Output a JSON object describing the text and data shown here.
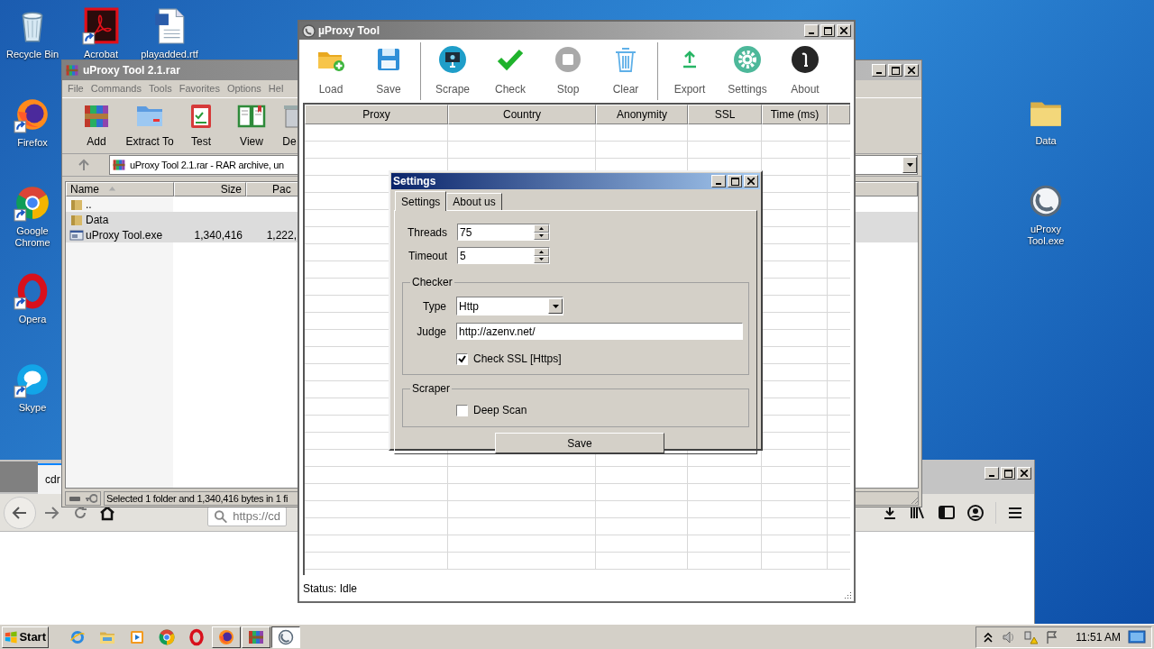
{
  "desktop_icons": [
    {
      "label": "Recycle Bin",
      "kind": "recycle",
      "shortcut": false
    },
    {
      "label": "Acrobat",
      "kind": "acrobat",
      "shortcut": true
    },
    {
      "label": "playadded.rtf",
      "kind": "document",
      "shortcut": false
    },
    {
      "label": "Firefox",
      "kind": "firefox",
      "shortcut": true
    },
    {
      "label": "Google Chrome",
      "kind": "chrome",
      "shortcut": true
    },
    {
      "label": "Opera",
      "kind": "opera",
      "shortcut": true
    },
    {
      "label": "Skype",
      "kind": "skype",
      "shortcut": true
    },
    {
      "label": "Data",
      "kind": "folder",
      "shortcut": false
    },
    {
      "label": "uProxy Tool.exe",
      "kind": "uproxy",
      "shortcut": false
    }
  ],
  "browser": {
    "tab": "cdr",
    "url": "https://cd"
  },
  "winrar": {
    "title": "uProxy Tool 2.1.rar",
    "menu": [
      "File",
      "Commands",
      "Tools",
      "Favorites",
      "Options",
      "Hel"
    ],
    "toolbar": [
      {
        "label": "Add",
        "kind": "add"
      },
      {
        "label": "Extract To",
        "kind": "extract"
      },
      {
        "label": "Test",
        "kind": "test"
      },
      {
        "label": "View",
        "kind": "view"
      },
      {
        "label": "De",
        "kind": "delete"
      }
    ],
    "path": "uProxy Tool 2.1.rar - RAR archive, un",
    "columns": [
      "Name",
      "Size",
      "Pac"
    ],
    "rows": [
      {
        "cells": [
          ".."
        ],
        "kind": "folder",
        "selected": false
      },
      {
        "cells": [
          "Data"
        ],
        "kind": "folder",
        "selected": true
      },
      {
        "cells": [
          "uProxy Tool.exe",
          "1,340,416",
          "1,222,"
        ],
        "kind": "file",
        "selected": true
      }
    ],
    "status": "Selected 1 folder and 1,340,416 bytes in 1 fi"
  },
  "uproxy": {
    "title": "µProxy Tool",
    "toolbar": [
      {
        "label": "Load",
        "kind": "load"
      },
      {
        "label": "Save",
        "kind": "save"
      },
      {
        "kind": "separator"
      },
      {
        "label": "Scrape",
        "kind": "scrape"
      },
      {
        "label": "Check",
        "kind": "check"
      },
      {
        "label": "Stop",
        "kind": "stop"
      },
      {
        "label": "Clear",
        "kind": "clear"
      },
      {
        "kind": "separator"
      },
      {
        "label": "Export",
        "kind": "export"
      },
      {
        "label": "Settings",
        "kind": "settings"
      },
      {
        "label": "About",
        "kind": "about"
      }
    ],
    "columns": [
      "Proxy",
      "Country",
      "Anonymity",
      "SSL",
      "Time (ms)"
    ],
    "status": "Status: Idle"
  },
  "settings": {
    "title": "Settings",
    "tabs": [
      {
        "label": "Settings",
        "selected": true
      },
      {
        "label": "About us",
        "selected": false
      }
    ],
    "threads": {
      "label": "Threads",
      "value": "75"
    },
    "timeout": {
      "label": "Timeout",
      "value": "5"
    },
    "checker": {
      "label": "Checker",
      "type": {
        "label": "Type",
        "value": "Http"
      },
      "judge": {
        "label": "Judge",
        "value": "http://azenv.net/"
      },
      "check_ssl": {
        "label": "Check SSL [Https]",
        "checked": true
      }
    },
    "scraper": {
      "label": "Scraper",
      "deep_scan": {
        "label": "Deep Scan",
        "checked": false
      }
    },
    "save": "Save"
  },
  "taskbar": {
    "start": "Start",
    "apps": [
      {
        "kind": "ie",
        "running": false,
        "selected": false
      },
      {
        "kind": "explorer",
        "running": false,
        "selected": false
      },
      {
        "kind": "media",
        "running": false,
        "selected": false
      },
      {
        "kind": "chrome",
        "running": false,
        "selected": false
      },
      {
        "kind": "opera",
        "running": false,
        "selected": false
      },
      {
        "kind": "firefox",
        "running": true,
        "selected": false
      },
      {
        "kind": "winrar",
        "running": true,
        "selected": false
      },
      {
        "kind": "uproxy",
        "running": true,
        "selected": true
      }
    ],
    "clock": "11:51 AM"
  }
}
